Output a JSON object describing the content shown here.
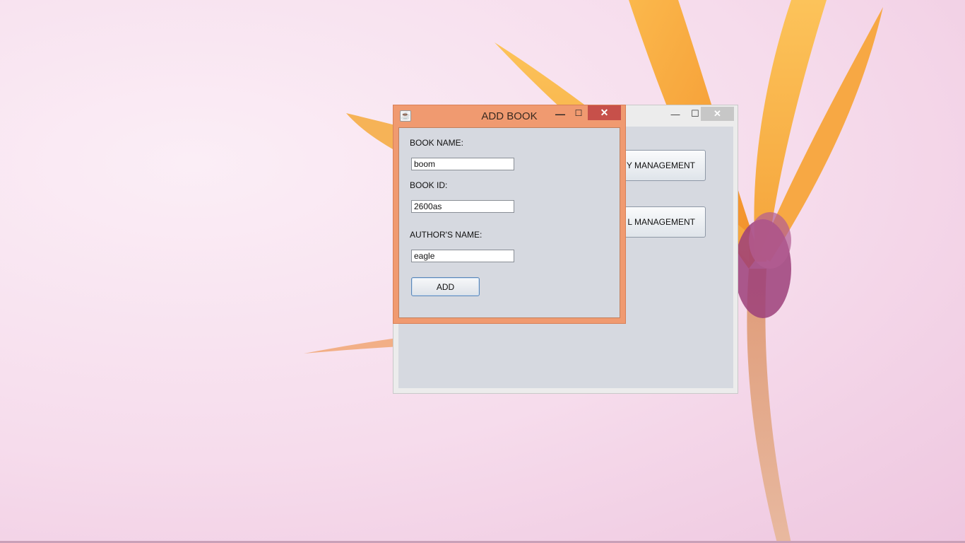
{
  "colors": {
    "dialog_frame": "#f09a70",
    "dialog_close": "#c7504a",
    "panel_bg": "#d6d9e0",
    "back_window_frame": "#ececec"
  },
  "back_window": {
    "controls": {
      "minimize": "—",
      "maximize": "☐",
      "close": "✕"
    },
    "buttons": [
      {
        "label": "Y MANAGEMENT"
      },
      {
        "label": "L MANAGEMENT"
      }
    ]
  },
  "dialog": {
    "title": "ADD BOOK",
    "app_icon": "java-app-icon",
    "controls": {
      "minimize": "—",
      "maximize": "☐",
      "close": "✕"
    },
    "form": {
      "book_name_label": "BOOK NAME:",
      "book_name_value": "boom",
      "book_id_label": "BOOK ID:",
      "book_id_value": "2600as",
      "author_label": "AUTHOR'S NAME:",
      "author_value": "eagle",
      "add_label": "ADD"
    }
  }
}
